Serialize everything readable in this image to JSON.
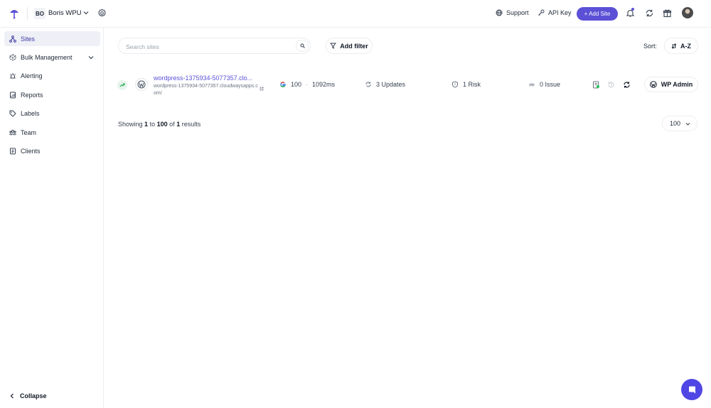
{
  "header": {
    "workspace_initials": "BO",
    "workspace_name": "Boris WPU",
    "support_label": "Support",
    "api_key_label": "API Key",
    "add_site_label": "+ Add Site",
    "accent_color": "#5b50d6"
  },
  "sidebar": {
    "items": [
      {
        "label": "Sites",
        "icon": "sitemap-icon",
        "active": true
      },
      {
        "label": "Bulk Management",
        "icon": "cube-icon",
        "active": false
      },
      {
        "label": "Alerting",
        "icon": "alert-icon",
        "active": false
      },
      {
        "label": "Reports",
        "icon": "reports-icon",
        "active": false
      },
      {
        "label": "Labels",
        "icon": "tag-icon",
        "active": false
      },
      {
        "label": "Team",
        "icon": "team-icon",
        "active": false
      },
      {
        "label": "Clients",
        "icon": "clients-icon",
        "active": false
      }
    ],
    "collapse_label": "Collapse"
  },
  "toolbar": {
    "search_placeholder": "Search sites",
    "add_filter_label": "Add filter",
    "sort_label": "Sort:",
    "sort_value": "A-Z"
  },
  "site": {
    "title": "wordpress-1375934-5077357.clo...",
    "url": "wordpress-1375934-5077357.cloudwaysapps.com/",
    "performance_score": "100",
    "separator": "·",
    "response_time": "1092ms",
    "updates": "3 Updates",
    "risk": "1 Risk",
    "php_issue": "0 Issue",
    "wp_admin_label": "WP Admin"
  },
  "pagination": {
    "showing_prefix": "Showing",
    "from": "1",
    "to_word": "to",
    "to": "100",
    "of_word": "of",
    "total": "1",
    "results_word": "results",
    "per_page": "100"
  }
}
